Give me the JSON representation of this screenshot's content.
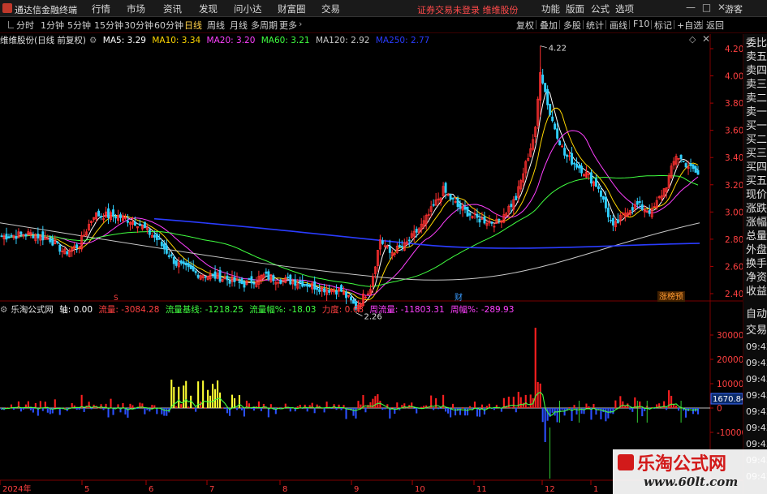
{
  "app": {
    "title": "通达信金融终端",
    "menu": [
      "行情",
      "市场",
      "资讯",
      "发现",
      "问小达",
      "财富圈",
      "交易"
    ],
    "notice": "证券交易未登录  维维股份",
    "right_menu": [
      "功能",
      "版面",
      "公式",
      "选项"
    ],
    "guest": "游客"
  },
  "toolbar": {
    "periods": [
      "分时",
      "1分钟",
      "5分钟",
      "15分钟",
      "30分钟",
      "60分钟",
      "日线",
      "周线",
      "月线",
      "多周期",
      "更多"
    ],
    "active_period": "日线",
    "tools": [
      "复权",
      "叠加",
      "多股",
      "统计",
      "画线",
      "F10",
      "标记",
      "+自选",
      "返回"
    ]
  },
  "main_legend": {
    "title": "维维股份(日线 前复权)",
    "items": [
      {
        "label": "MA5: 3.29",
        "color": "#ffffff"
      },
      {
        "label": "MA10: 3.34",
        "color": "#ffd700"
      },
      {
        "label": "MA20: 3.20",
        "color": "#ff40ff"
      },
      {
        "label": "MA60: 3.21",
        "color": "#40ff40"
      },
      {
        "label": "MA120: 2.92",
        "color": "#c8c8c8"
      },
      {
        "label": "MA250: 2.77",
        "color": "#2a3cff"
      }
    ]
  },
  "price_axis": [
    "4.20",
    "4.00",
    "3.80",
    "3.60",
    "3.40",
    "3.20",
    "3.00",
    "2.80",
    "2.60",
    "2.40"
  ],
  "annotations": {
    "high": "4.22",
    "low": "2.26",
    "marker_s": "S",
    "marker_cai": "财",
    "tag": "涨榜预"
  },
  "indicator_legend": {
    "name": "乐淘公式网",
    "items": [
      {
        "label": "轴: 0.00",
        "color": "#ffffff"
      },
      {
        "label": "流量: -3084.28",
        "color": "#ff4040"
      },
      {
        "label": "流量基线: -1218.25",
        "color": "#40ff40"
      },
      {
        "label": "流量幅%: -18.03",
        "color": "#40ff40"
      },
      {
        "label": "力度: 0.68",
        "color": "#ff4040"
      },
      {
        "label": "周流量: -11803.31",
        "color": "#ff40ff"
      },
      {
        "label": "周幅%: -289.93",
        "color": "#ff40ff"
      }
    ]
  },
  "indicator_axis": [
    "30000",
    "20000",
    "10000",
    "0",
    "-10000"
  ],
  "indicator_value": "1670.84",
  "date_axis": [
    "2024年",
    "5",
    "6",
    "7",
    "8",
    "9",
    "10",
    "11",
    "12",
    "1"
  ],
  "right_panel": [
    "委比",
    "卖五",
    "卖四",
    "卖三",
    "卖二",
    "卖一",
    "买一",
    "买二",
    "买三",
    "买四",
    "买五",
    "现价",
    "涨跌",
    "涨幅",
    "总量",
    "外盘",
    "换手",
    "净资",
    "收益",
    "自动",
    "交易",
    "09:43",
    "09:43",
    "09:43",
    "09:43",
    "09:43",
    "09:43",
    "09:43",
    "09:43",
    "09:43"
  ],
  "watermark": {
    "title": "乐淘公式网",
    "url": "www.60lt.com"
  },
  "colors": {
    "up": "#ff3030",
    "down": "#30d0ff",
    "bg": "#000000",
    "grid": "#3a0000"
  }
}
